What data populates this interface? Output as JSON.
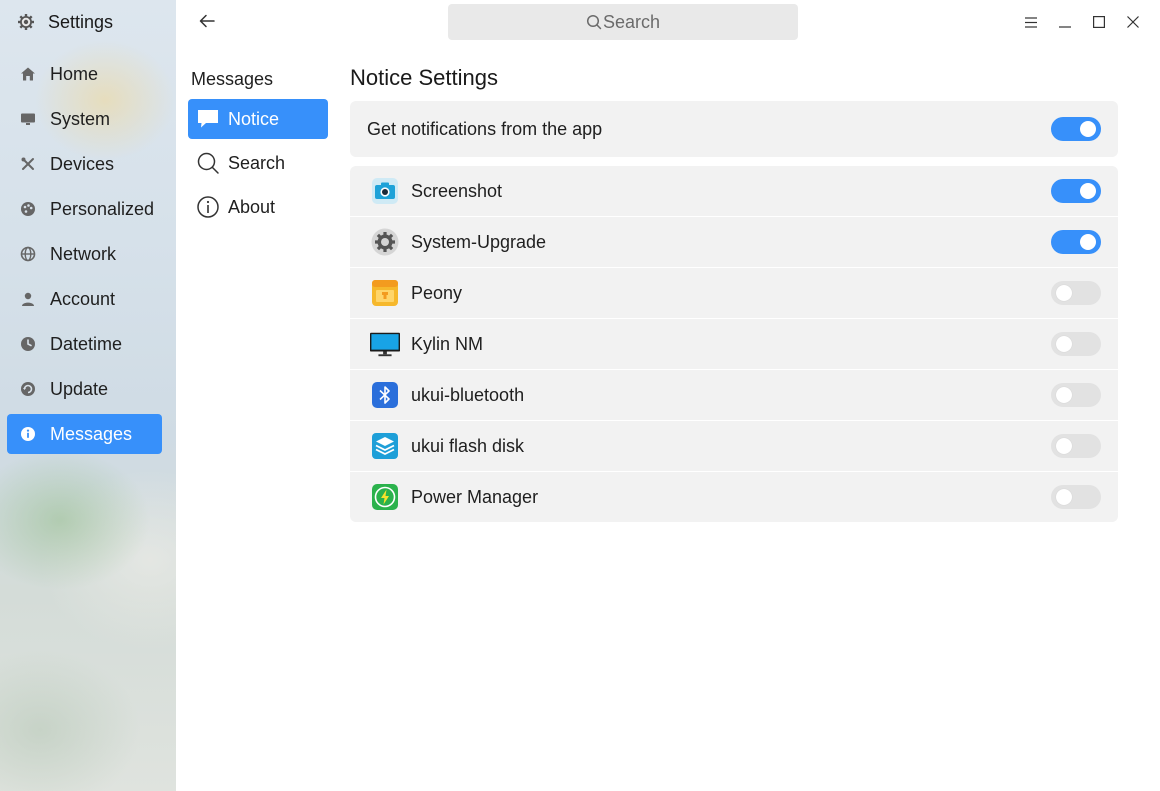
{
  "app": {
    "title": "Settings",
    "icon": "gear-icon"
  },
  "sidebar": {
    "items": [
      {
        "label": "Home",
        "icon": "home-icon"
      },
      {
        "label": "System",
        "icon": "monitor-icon"
      },
      {
        "label": "Devices",
        "icon": "devices-icon"
      },
      {
        "label": "Personalized",
        "icon": "palette-icon"
      },
      {
        "label": "Network",
        "icon": "globe-icon"
      },
      {
        "label": "Account",
        "icon": "user-icon"
      },
      {
        "label": "Datetime",
        "icon": "clock-icon"
      },
      {
        "label": "Update",
        "icon": "update-icon"
      },
      {
        "label": "Messages",
        "icon": "info-icon",
        "active": true
      }
    ]
  },
  "topbar": {
    "search_placeholder": "Search"
  },
  "section": {
    "title": "Messages",
    "items": [
      {
        "label": "Notice",
        "icon": "chat-bubble-icon",
        "active": true
      },
      {
        "label": "Search",
        "icon": "search-icon"
      },
      {
        "label": "About",
        "icon": "info-circle-icon"
      }
    ]
  },
  "main": {
    "title": "Notice Settings",
    "master": {
      "label": "Get notifications from the app",
      "enabled": true
    },
    "apps": [
      {
        "name": "Screenshot",
        "icon": "camera-icon",
        "enabled": true
      },
      {
        "name": "System-Upgrade",
        "icon": "gear-icon",
        "enabled": true
      },
      {
        "name": "Peony",
        "icon": "folder-icon",
        "enabled": false
      },
      {
        "name": "Kylin NM",
        "icon": "monitor-icon",
        "enabled": false
      },
      {
        "name": "ukui-bluetooth",
        "icon": "bluetooth-icon",
        "enabled": false
      },
      {
        "name": "ukui flash disk",
        "icon": "flash-disk-icon",
        "enabled": false
      },
      {
        "name": "Power Manager",
        "icon": "power-icon",
        "enabled": false
      }
    ]
  },
  "colors": {
    "accent": "#3790fa",
    "row_bg": "#f2f2f2",
    "toggle_off": "#e2e2e2"
  }
}
